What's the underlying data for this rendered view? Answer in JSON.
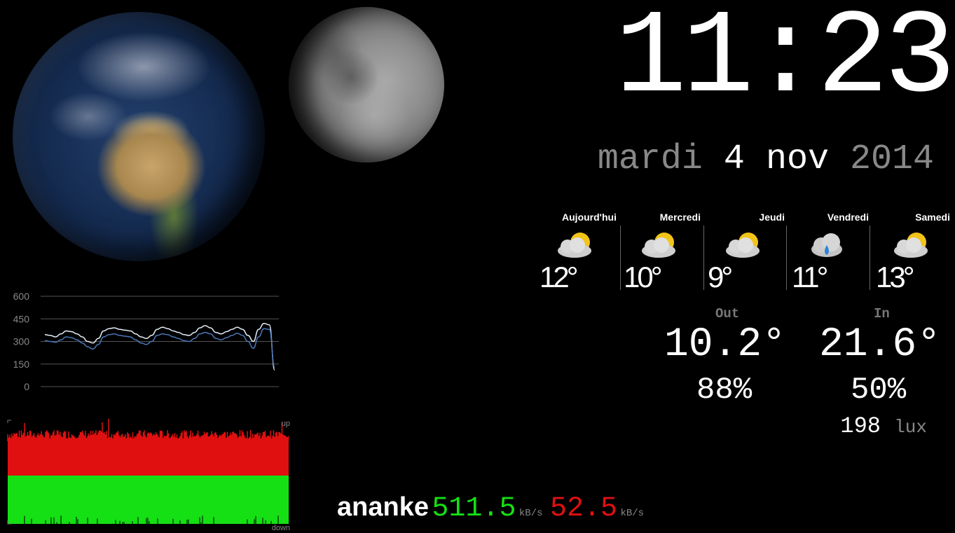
{
  "clock": {
    "time": "11:23"
  },
  "date": {
    "weekday": "mardi",
    "day": "4",
    "month": "nov",
    "year": "2014"
  },
  "forecast": [
    {
      "day": "Aujourd'hui",
      "temp": "12°",
      "icon": "partly-cloudy-icon"
    },
    {
      "day": "Mercredi",
      "temp": "10°",
      "icon": "partly-cloudy-icon"
    },
    {
      "day": "Jeudi",
      "temp": "9°",
      "icon": "partly-cloudy-icon"
    },
    {
      "day": "Vendredi",
      "temp": "11°",
      "icon": "rain-cloud-icon"
    },
    {
      "day": "Samedi",
      "temp": "13°",
      "icon": "partly-cloudy-icon"
    }
  ],
  "sensors": {
    "out": {
      "label": "Out",
      "temp": "10.2°",
      "humidity": "88%"
    },
    "in": {
      "label": "In",
      "temp": "21.6°",
      "humidity": "50%"
    },
    "light": {
      "value": "198",
      "unit": "lux"
    }
  },
  "network": {
    "host": "ananke",
    "down_rate": "511.5",
    "down_unit": "kB/s",
    "up_rate": "52.5",
    "up_unit": "kB/s",
    "graph_label_up": "up",
    "graph_label_down": "down"
  },
  "colors": {
    "down": "#14e014",
    "up": "#e01010",
    "line1": "#e6eef8",
    "line2": "#4a78b8"
  },
  "chart_data": {
    "type": "line",
    "ylim": [
      0,
      600
    ],
    "yticks": [
      "600",
      "450",
      "300",
      "150",
      "0"
    ],
    "series": [
      {
        "values": [
          345,
          340,
          330,
          350,
          370,
          365,
          350,
          330,
          300,
          290,
          320,
          370,
          385,
          390,
          380,
          375,
          370,
          350,
          330,
          320,
          340,
          380,
          395,
          385,
          370,
          360,
          345,
          340,
          360,
          390,
          405,
          390,
          360,
          350,
          365,
          380,
          395,
          380,
          340,
          300,
          380,
          420,
          410,
          110
        ]
      },
      {
        "values": [
          305,
          300,
          295,
          310,
          330,
          325,
          310,
          290,
          265,
          250,
          280,
          330,
          345,
          350,
          340,
          335,
          330,
          310,
          290,
          280,
          300,
          340,
          350,
          345,
          330,
          320,
          305,
          300,
          320,
          350,
          360,
          350,
          320,
          310,
          325,
          340,
          355,
          340,
          300,
          255,
          330,
          385,
          380,
          130
        ]
      }
    ]
  }
}
